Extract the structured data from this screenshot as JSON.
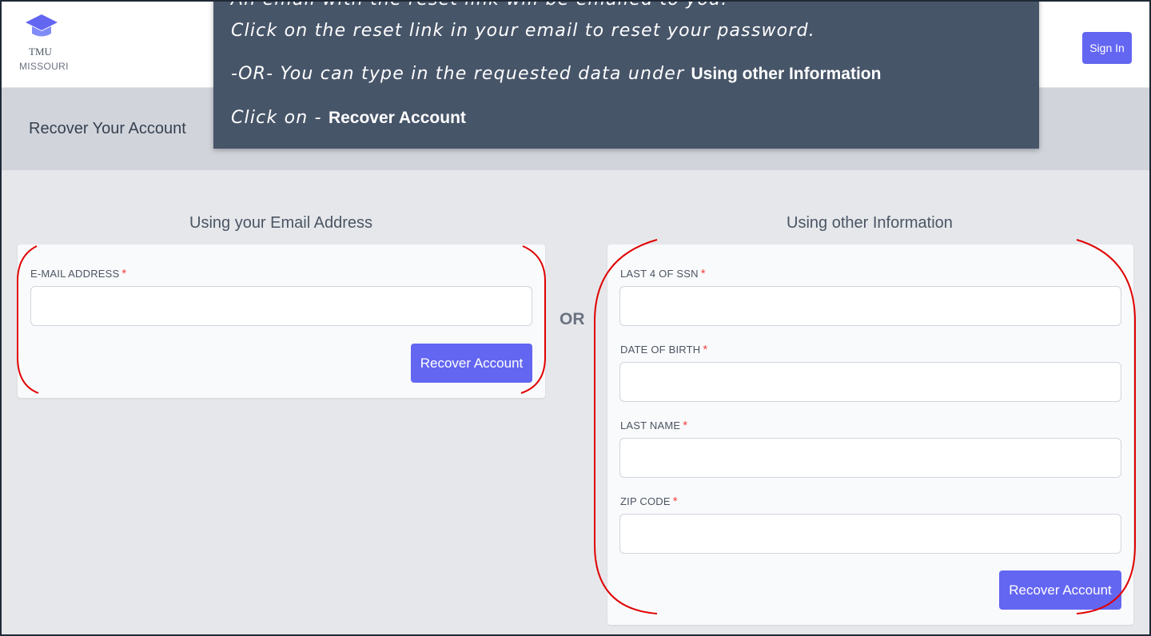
{
  "header": {
    "logo_tmu": "TMU",
    "logo_state": "MISSOURI",
    "signin_label": "Sign In"
  },
  "page_title": "Recover Your Account",
  "tooltip": {
    "line1": "An email with the reset link will be emailed to you.",
    "line2": "Click on the reset link in your email to reset your password.",
    "line3_prefix": "-OR- You can type in the requested data under ",
    "line3_bold": "Using other Information",
    "line4_prefix": "Click on - ",
    "line4_bold": "Recover Account"
  },
  "left_section": {
    "title": "Using your Email Address",
    "email_label": "E-MAIL ADDRESS",
    "required_mark": "*",
    "email_value": "",
    "button_label": "Recover Account"
  },
  "or_label": "OR",
  "right_section": {
    "title": "Using other Information",
    "fields": [
      {
        "label": "LAST 4 OF SSN",
        "value": ""
      },
      {
        "label": "DATE OF BIRTH",
        "value": ""
      },
      {
        "label": "LAST NAME",
        "value": ""
      },
      {
        "label": "ZIP CODE",
        "value": ""
      }
    ],
    "required_mark": "*",
    "button_label": "Recover Account"
  },
  "colors": {
    "accent": "#6366f1",
    "tooltip_bg": "#475569",
    "annotation": "#e00000",
    "required": "#ef4444"
  },
  "icons": {
    "logo": "graduation-cap-icon"
  }
}
